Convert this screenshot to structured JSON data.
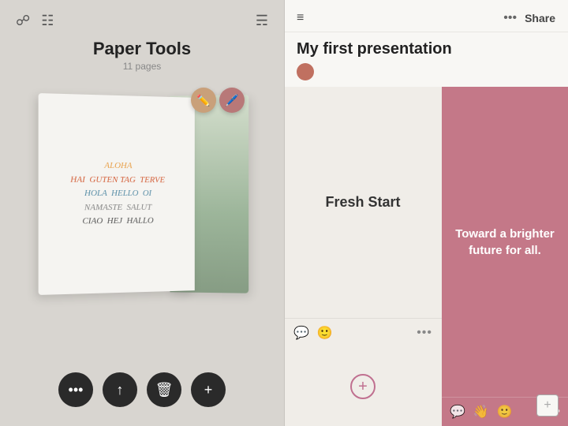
{
  "left": {
    "title": "Paper Tools",
    "subtitle": "11 pages",
    "hello_lines": [
      "ALOHA",
      "HAI  GUTEN TAG  TERVE",
      "HOLA  HELLO  OI",
      "NAMASTE  SALUT",
      "CIAO  HEJ  HALLO"
    ],
    "bottom_buttons": [
      "•••",
      "↑",
      "🗑",
      "+"
    ]
  },
  "right": {
    "menu_icon": "≡",
    "dots_label": "•••",
    "share_label": "Share",
    "presentation_title": "My first presentation",
    "slide1": {
      "title": "Fresh Start",
      "add_icon": "+"
    },
    "slide2": {
      "text": "Toward a brighter future for all."
    },
    "bottom_add_label": "+"
  }
}
